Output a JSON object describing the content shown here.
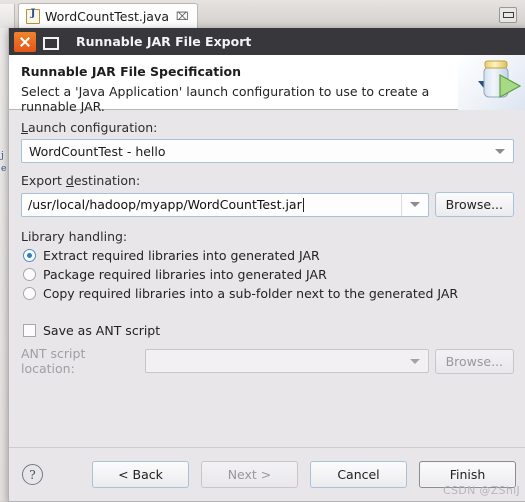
{
  "eclipse": {
    "tab": {
      "label": "WordCountTest.java",
      "icon": "java-file-icon",
      "close": "⌧"
    },
    "minimize_icon": "minimize-icon",
    "gutter_glyphs": "j\ne"
  },
  "dialog": {
    "titlebar": {
      "title": "Runnable JAR File Export",
      "close_icon": "close-icon",
      "maximize_icon": "maximize-icon"
    },
    "banner": {
      "title": "Runnable JAR File Specification",
      "description": "Select a 'Java Application' launch configuration to use to create a runnable JAR.",
      "icon": "runnable-jar-icon"
    },
    "launch_configuration": {
      "label": "Launch configuration:",
      "value": "WordCountTest - hello",
      "dropdown_icon": "chevron-down-icon"
    },
    "export_destination": {
      "label": "Export destination:",
      "value": "/usr/local/hadoop/myapp/WordCountTest.jar",
      "placeholder": "",
      "dropdown_icon": "chevron-down-icon",
      "browse_label": "Browse..."
    },
    "library_handling": {
      "label": "Library handling:",
      "options": [
        {
          "label": "Extract required libraries into generated JAR",
          "selected": true
        },
        {
          "label": "Package required libraries into generated JAR",
          "selected": false
        },
        {
          "label": "Copy required libraries into a sub-folder next to the generated JAR",
          "selected": false
        }
      ]
    },
    "ant": {
      "checkbox_label": "Save as ANT script",
      "checked": false,
      "location_label": "ANT script location:",
      "location_value": "",
      "location_placeholder": "",
      "dropdown_icon": "chevron-down-icon",
      "browse_label": "Browse...",
      "disabled": true
    },
    "footer": {
      "help_icon": "help-icon",
      "help_glyph": "?",
      "buttons": [
        {
          "label": "< Back",
          "state": "enabled"
        },
        {
          "label": "Next >",
          "state": "disabled"
        },
        {
          "label": "Cancel",
          "state": "enabled"
        },
        {
          "label": "Finish",
          "state": "default"
        }
      ]
    }
  },
  "watermark": "CSDN @ZShiJ",
  "colors": {
    "accent_orange": "#e4551a",
    "dialog_bg": "#e9e6ea",
    "titlebar_bg": "#38373c",
    "radio_blue": "#2b7fc4",
    "field_border": "#a8c0d8"
  }
}
